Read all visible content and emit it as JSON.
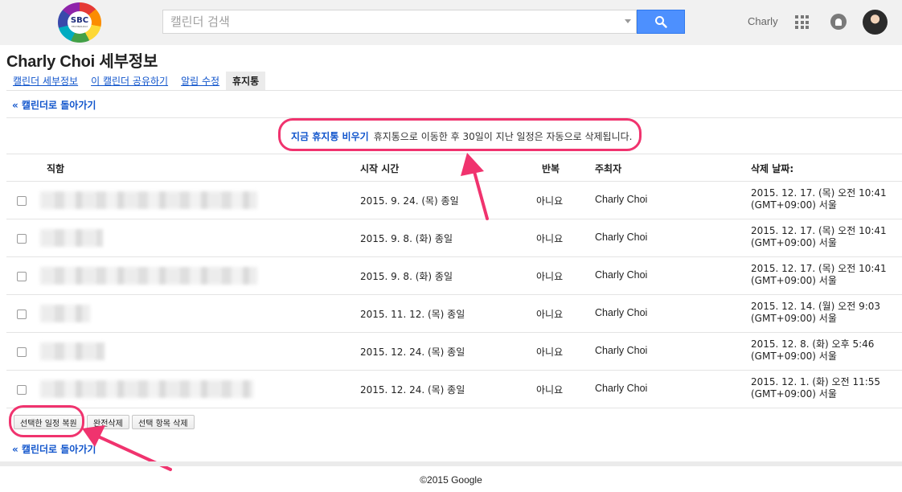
{
  "header": {
    "logo_text": "SBC",
    "logo_subtext": "TECHNOLOGY",
    "search_placeholder": "캘린더 검색",
    "user_name": "Charly",
    "icons": [
      "search-icon",
      "apps-grid-icon",
      "notification-bell-icon",
      "profile-avatar"
    ]
  },
  "page": {
    "title": "Charly Choi 세부정보",
    "tabs": [
      {
        "label": "캘린더 세부정보",
        "active": false
      },
      {
        "label": "이 캘린더 공유하기",
        "active": false
      },
      {
        "label": "알림 수정",
        "active": false
      },
      {
        "label": "휴지통",
        "active": true
      }
    ],
    "back_link_top": "« 캘린더로 돌아가기",
    "back_link_bottom": "« 캘린더로 돌아가기"
  },
  "notice": {
    "empty_now": "지금 휴지통 비우기",
    "text": "휴지통으로 이동한 후 30일이 지난 일정은 자동으로 삭제됩니다."
  },
  "table": {
    "headers": {
      "title": "직함",
      "start": "시작 시간",
      "repeat": "반복",
      "organizer": "주최자",
      "deleted": "삭제 날짜:"
    },
    "rows": [
      {
        "title_redacted": true,
        "start": "2015. 9. 24. (목) 종일",
        "repeat": "아니요",
        "organizer": "Charly Choi",
        "deleted_line1": "2015. 12. 17. (목) 오전 10:41",
        "deleted_line2": "(GMT+09:00) 서울"
      },
      {
        "title_redacted": true,
        "start": "2015. 9. 8. (화) 종일",
        "repeat": "아니요",
        "organizer": "Charly Choi",
        "deleted_line1": "2015. 12. 17. (목) 오전 10:41",
        "deleted_line2": "(GMT+09:00) 서울"
      },
      {
        "title_redacted": true,
        "start": "2015. 9. 8. (화) 종일",
        "repeat": "아니요",
        "organizer": "Charly Choi",
        "deleted_line1": "2015. 12. 17. (목) 오전 10:41",
        "deleted_line2": "(GMT+09:00) 서울"
      },
      {
        "title_redacted": true,
        "start": "2015. 11. 12. (목) 종일",
        "repeat": "아니요",
        "organizer": "Charly Choi",
        "deleted_line1": "2015. 12. 14. (월) 오전 9:03",
        "deleted_line2": "(GMT+09:00) 서울"
      },
      {
        "title_redacted": true,
        "start": "2015. 12. 24. (목) 종일",
        "repeat": "아니요",
        "organizer": "Charly Choi",
        "deleted_line1": "2015. 12. 8. (화) 오후 5:46",
        "deleted_line2": "(GMT+09:00) 서울"
      },
      {
        "title_redacted": true,
        "start": "2015. 12. 24. (목) 종일",
        "repeat": "아니요",
        "organizer": "Charly Choi",
        "deleted_line1": "2015. 12. 1. (화) 오전 11:55",
        "deleted_line2": "(GMT+09:00) 서울"
      }
    ]
  },
  "actions": {
    "restore": "선택한 일정 복원",
    "delete_forever": "완전삭제",
    "delete_selected": "선택 항목 삭제"
  },
  "footer": {
    "copyright": "©2015 Google"
  },
  "colors": {
    "link": "#1155cc",
    "highlight": "#f0336e",
    "search_button": "#4d90fe"
  }
}
